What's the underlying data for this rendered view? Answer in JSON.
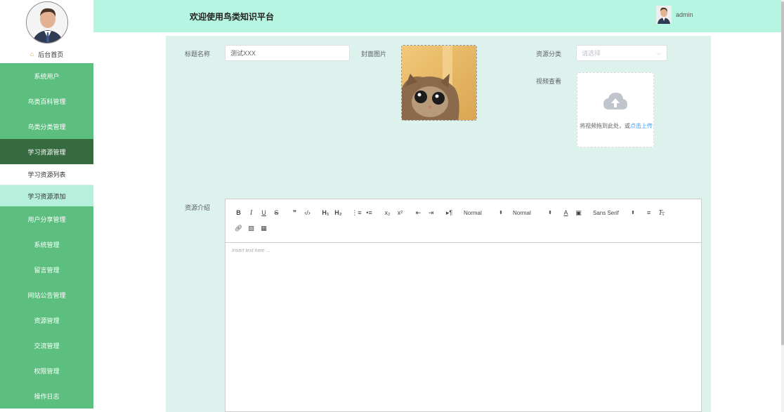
{
  "header": {
    "title": "欢迎使用鸟类知识平台",
    "username": "admin"
  },
  "sidebar": {
    "home_label": "后台首页",
    "items": [
      {
        "label": "系统用户"
      },
      {
        "label": "鸟类百科管理"
      },
      {
        "label": "鸟类分类管理"
      },
      {
        "label": "学习资源管理"
      },
      {
        "label": "学习资源列表"
      },
      {
        "label": "学习资源添加"
      },
      {
        "label": "用户分享管理"
      },
      {
        "label": "系统管理"
      },
      {
        "label": "留言管理"
      },
      {
        "label": "网站公告管理"
      },
      {
        "label": "资源管理"
      },
      {
        "label": "交流管理"
      },
      {
        "label": "权限管理"
      },
      {
        "label": "操作日志"
      }
    ]
  },
  "form": {
    "title_label": "标题名称",
    "title_value": "测试XXX",
    "cover_label": "封面图片",
    "category_label": "资源分类",
    "category_placeholder": "请选择",
    "video_label": "视频查看",
    "upload_tip": "将视频拖到此处，或",
    "upload_link": "点击上传",
    "intro_label": "资源介绍"
  },
  "editor": {
    "header_picker": "Normal",
    "size_picker": "Normal",
    "font_picker": "Sans Serif",
    "placeholder": "Insert text here ..."
  },
  "colors": {
    "sidebar_green": "#5cbf7f",
    "sidebar_active": "#356b3e",
    "header_bg": "#b6f5e1",
    "panel_bg": "#ddf1ed",
    "link_blue": "#409eff"
  }
}
